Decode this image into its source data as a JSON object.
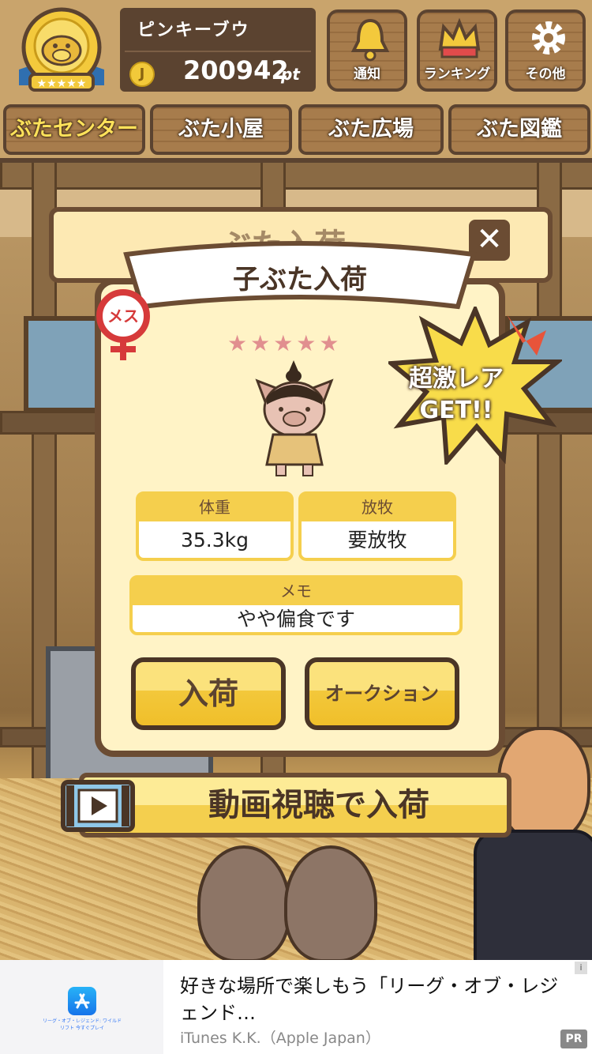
{
  "user": {
    "name": "ピンキーブウ",
    "coin_symbol": "J",
    "points": "200942",
    "points_unit": "pt"
  },
  "top_buttons": [
    {
      "label": "通知",
      "icon": "bell-icon"
    },
    {
      "label": "ランキング",
      "icon": "crown-icon"
    },
    {
      "label": "その他",
      "icon": "gear-icon"
    }
  ],
  "nav_tabs": [
    {
      "label": "ぶたセンター",
      "active": true
    },
    {
      "label": "ぶた小屋",
      "active": false
    },
    {
      "label": "ぶた広場",
      "active": false
    },
    {
      "label": "ぶた図鑑",
      "active": false
    }
  ],
  "background_dialog": {
    "title": "ぶた入荷"
  },
  "modal": {
    "title": "子ぶた入荷",
    "gender_label": "メス",
    "rarity_stars": 5,
    "stars_text": "★★★★★",
    "badge_line1": "超激レア",
    "badge_line2": "GET!!",
    "weight_header": "体重",
    "weight_value": "35.3kg",
    "grazing_header": "放牧",
    "grazing_value": "要放牧",
    "memo_header": "メモ",
    "memo_value": "やや偏食です",
    "accept_button": "入荷",
    "auction_button": "オークション"
  },
  "video_button": "動画視聴で入荷",
  "ad": {
    "title": "好きな場所で楽しもう「リーグ・オブ・レジェンド…",
    "source": "iTunes K.K.（Apple Japan）",
    "app_caption": "リーグ・オブ・レジェンド: ワイルドリフト 今すぐプレイ",
    "info_mark": "i",
    "badge": "PR"
  },
  "colors": {
    "wood_dark": "#5b4330",
    "card_bg": "#fff3c6",
    "accent_yellow": "#f5cf4d",
    "star_pink": "#e18f8f",
    "gender_red": "#d63a3a"
  }
}
